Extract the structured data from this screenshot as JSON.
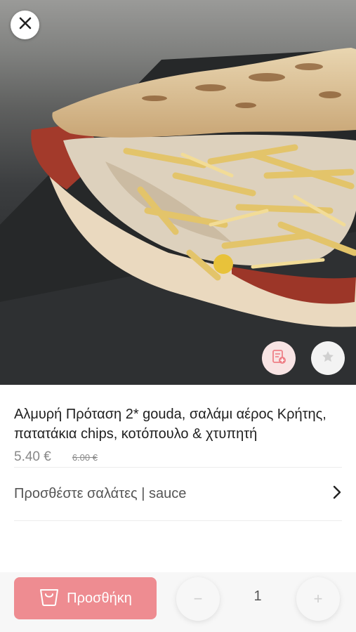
{
  "product": {
    "title": "Αλμυρή Πρόταση 2* gouda, σαλάμι αέρος Κρήτης, πατατάκια chips, κοτόπουλο & χτυπητή",
    "price": "5.40 €",
    "old_price": "6.00 €",
    "image_icon": "food-photo"
  },
  "options": {
    "label": "Προσθέστε σαλάτες | sauce",
    "icon": "chevron-right-icon"
  },
  "actions": {
    "close_icon": "close-icon",
    "note_icon": "note-add-icon",
    "favorite_icon": "star-icon"
  },
  "cart": {
    "add_label": "Προσθήκη",
    "add_icon": "shopping-bag-icon",
    "quantity": "1",
    "minus_label": "−",
    "plus_label": "+"
  },
  "colors": {
    "accent": "#ee8c91",
    "note_bg": "#f8e4e4"
  }
}
